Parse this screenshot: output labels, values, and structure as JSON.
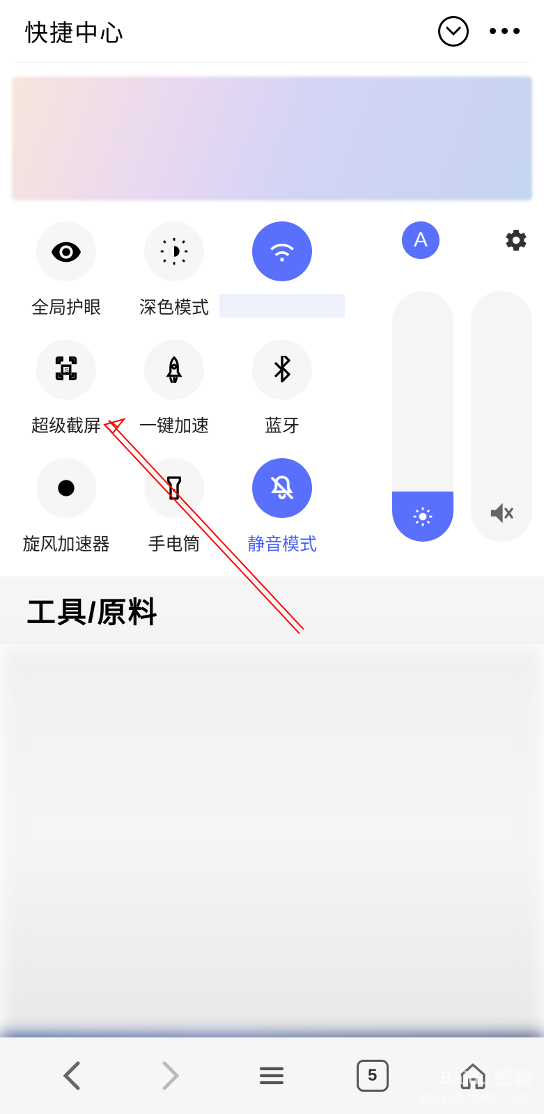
{
  "header": {
    "title": "快捷中心"
  },
  "toggles": [
    {
      "label": "全局护眼",
      "active": false,
      "icon": "eye"
    },
    {
      "label": "深色模式",
      "active": false,
      "icon": "dark"
    },
    {
      "label": "",
      "active": true,
      "icon": "wifi",
      "hidden_label": true
    },
    {
      "label": "超级截屏",
      "active": false,
      "icon": "screenshot"
    },
    {
      "label": "一键加速",
      "active": false,
      "icon": "rocket"
    },
    {
      "label": "蓝牙",
      "active": false,
      "icon": "bluetooth"
    },
    {
      "label": "旋风加速器",
      "active": false,
      "icon": "dot"
    },
    {
      "label": "手电筒",
      "active": false,
      "icon": "flashlight"
    },
    {
      "label": "静音模式",
      "active": true,
      "icon": "mute",
      "label_active": true
    }
  ],
  "auto_brightness_badge": "A",
  "sliders": {
    "brightness_percent": 20,
    "volume_percent": 0,
    "volume_muted": true
  },
  "section": {
    "title": "工具/原料"
  },
  "bottom_nav": {
    "tab_count": "5"
  },
  "watermark": {
    "brand": "Baidu 经验",
    "url": "jingyan.baidu.com"
  }
}
